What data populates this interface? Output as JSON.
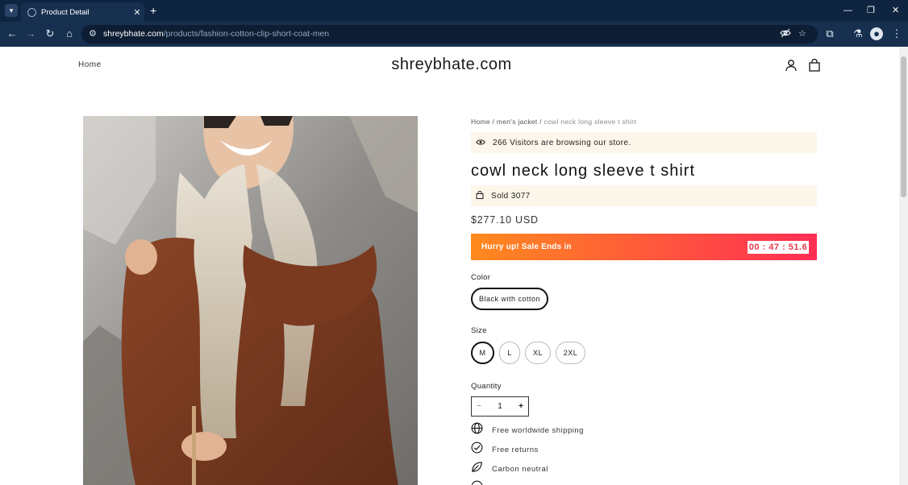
{
  "browser": {
    "tab_title": "Product Detail",
    "tab_close": "✕",
    "new_tab": "+",
    "url_host": "shreybhate.com",
    "url_path": "/products/fashion-cotton-clip-short-coat-men"
  },
  "header": {
    "home_label": "Home",
    "logo": "shreybhate.com"
  },
  "breadcrumb": {
    "home": "Home",
    "sep": " / ",
    "category": "men's jacket",
    "current": "cowl neck long sleeve t shirt"
  },
  "visitors_text": "266 Visitors are browsing our store.",
  "product": {
    "title": "cowl neck long sleeve t shirt",
    "sold_text": "Sold 3077",
    "price": "$277.10 USD"
  },
  "sale": {
    "label": "Hurry up! Sale Ends in",
    "timer": "00 : 47 : 51.6"
  },
  "color": {
    "label": "Color",
    "options": [
      "Black with cotton"
    ]
  },
  "size": {
    "label": "Size",
    "options": [
      "M",
      "L",
      "XL",
      "2XL"
    ],
    "selected": "M"
  },
  "quantity": {
    "label": "Quantity",
    "value": "1",
    "minus": "−",
    "plus": "+"
  },
  "features": [
    "Free worldwide shipping",
    "Free returns",
    "Carbon neutral"
  ],
  "colors": {
    "browser_bg": "#0f2440",
    "toolbar_bg": "#17304f",
    "notice_bg": "#fdf6ea",
    "sale_gradient_start": "#ff8a1e",
    "sale_gradient_end": "#ff2e55",
    "timer_text": "#e8364a"
  }
}
